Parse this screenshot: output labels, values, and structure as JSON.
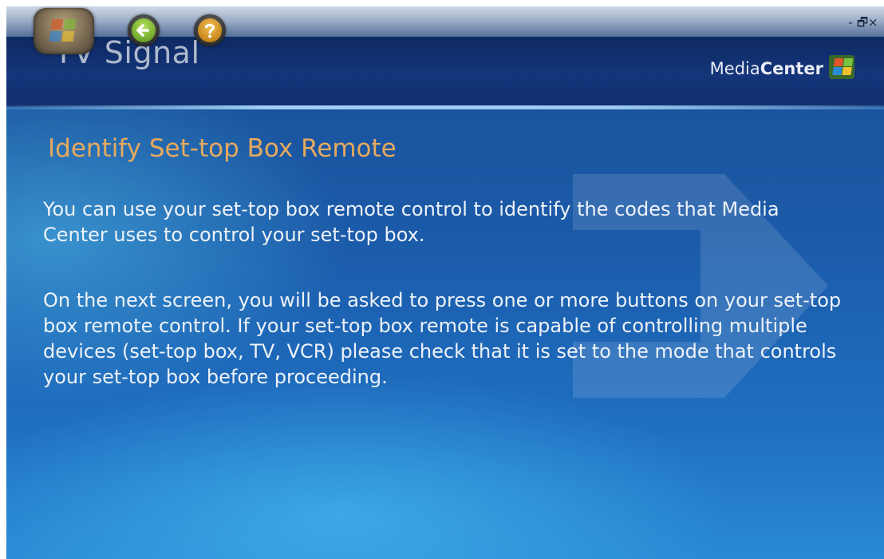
{
  "window": {
    "controls": [
      "-",
      "🗗",
      "×"
    ]
  },
  "header": {
    "page_title": "TV Signal",
    "brand_light": "Media",
    "brand_bold": "Center"
  },
  "icons": {
    "start": "windows-orb-icon",
    "back": "back-arrow-icon",
    "help": "help-question-icon",
    "brand": "windows-flag-icon"
  },
  "content": {
    "heading": "Identify Set-top Box Remote",
    "paragraph_1": "You can use your set-top box remote control to identify the codes that Media Center uses to control your set-top box.",
    "paragraph_2": "On the next screen, you will be asked to press one or more buttons on your set-top box remote control. If your set-top box remote is capable of controlling multiple devices (set-top box, TV, VCR) please check that it is set to the mode that controls your set-top box before proceeding."
  },
  "colors": {
    "heading": "#e7a95e",
    "background": "#1b5aa8",
    "back_button": "#6ea82a",
    "help_button": "#c7871e"
  }
}
